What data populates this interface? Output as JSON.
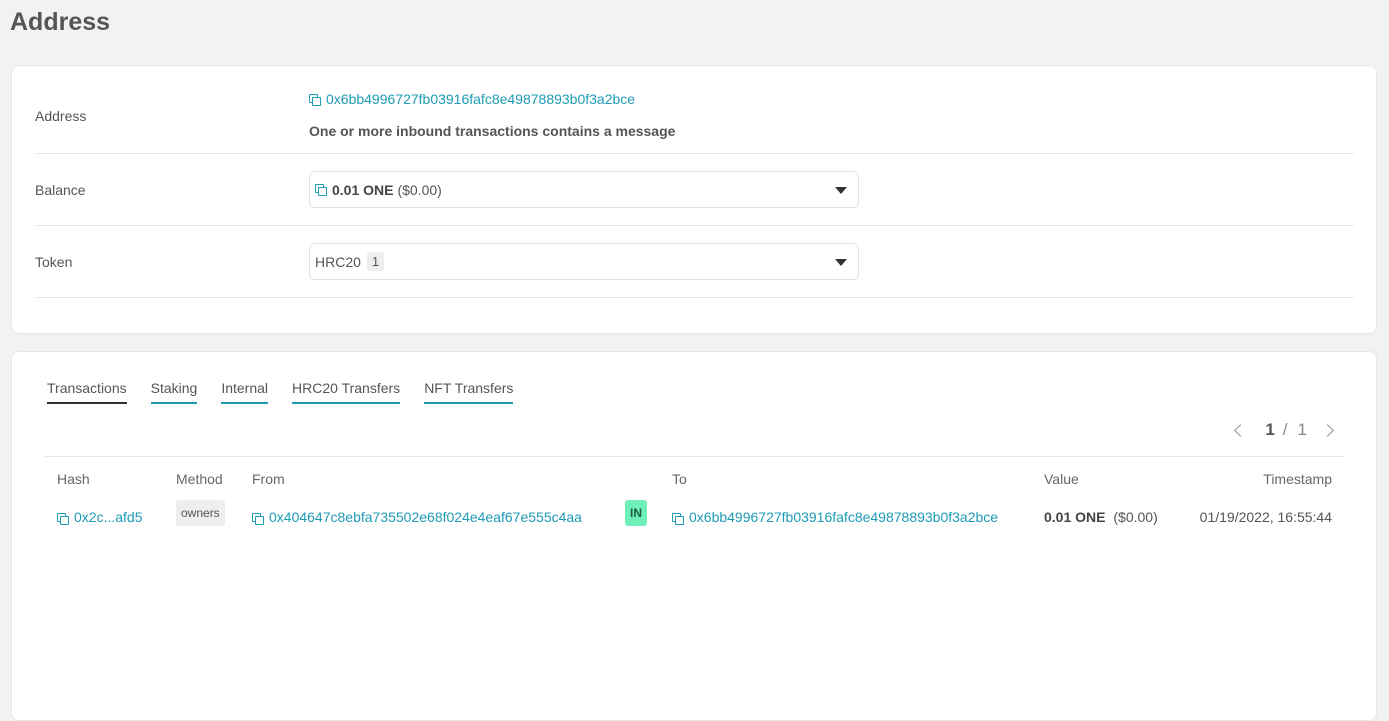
{
  "page": {
    "title": "Address"
  },
  "details": {
    "address": {
      "label": "Address",
      "value": "0x6bb4996727fb03916fafc8e49878893b0f3a2bce",
      "note": "One or more inbound transactions contains a message"
    },
    "balance": {
      "label": "Balance",
      "amount": "0.01 ONE",
      "usd": "($0.00)"
    },
    "token": {
      "label": "Token",
      "type": "HRC20",
      "count": "1"
    }
  },
  "tabs": [
    {
      "label": "Transactions",
      "active": true
    },
    {
      "label": "Staking"
    },
    {
      "label": "Internal"
    },
    {
      "label": "HRC20 Transfers"
    },
    {
      "label": "NFT Transfers"
    }
  ],
  "pager": {
    "current": "1",
    "separator": "/",
    "total": "1"
  },
  "table": {
    "headers": {
      "hash": "Hash",
      "method": "Method",
      "from": "From",
      "to": "To",
      "value": "Value",
      "timestamp": "Timestamp"
    },
    "rows": [
      {
        "hash": "0x2c...afd5",
        "method": "owners",
        "from": "0x404647c8ebfa735502e68f024e4eaf67e555c4aa",
        "direction": "IN",
        "to": "0x6bb4996727fb03916fafc8e49878893b0f3a2bce",
        "value": "0.01 ONE",
        "usd": "($0.00)",
        "timestamp": "01/19/2022, 16:55:44"
      }
    ]
  },
  "colors": {
    "link": "#1e9bb5",
    "in_badge": "#6ef0b8"
  }
}
